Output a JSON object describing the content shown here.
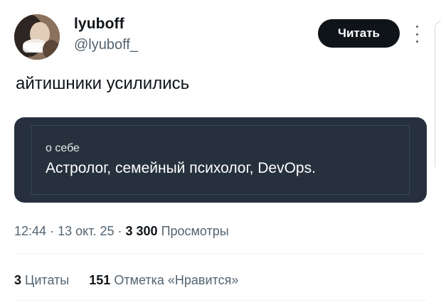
{
  "author": {
    "name": "lyuboff",
    "handle": "@lyuboff_"
  },
  "actions": {
    "follow_label": "Читать"
  },
  "tweet": {
    "text": "айтишники усилились"
  },
  "bio_card": {
    "label": "о себе",
    "value": "Астролог, семейный психолог, DevOps."
  },
  "meta": {
    "time": "12:44",
    "separator": "·",
    "date": "13 окт. 25",
    "views_count": "3 300",
    "views_label": "Просмотры"
  },
  "stats": {
    "quotes_count": "3",
    "quotes_label": "Цитаты",
    "likes_count": "151",
    "likes_label": "Отметка «Нравится»"
  }
}
